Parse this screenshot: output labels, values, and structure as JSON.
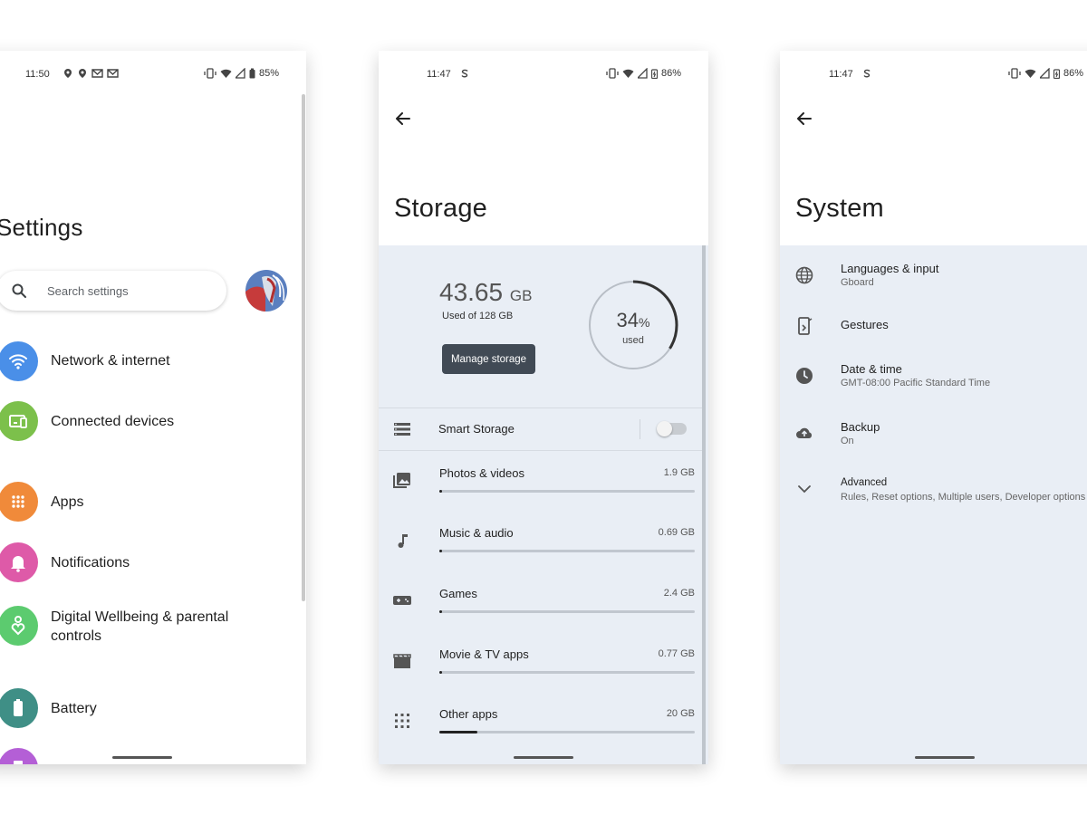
{
  "phone1": {
    "status": {
      "time": "11:50",
      "battery": "85%"
    },
    "title": "Settings",
    "search_placeholder": "Search settings",
    "items": [
      {
        "label": "Network & internet",
        "color": "#4a8fe8",
        "icon": "wifi-icon"
      },
      {
        "label": "Connected devices",
        "color": "#7cc04b",
        "icon": "connected-devices-icon"
      },
      {
        "label": "Apps",
        "color": "#f08a3a",
        "icon": "apps-grid-icon"
      },
      {
        "label": "Notifications",
        "color": "#de5aa8",
        "icon": "bell-icon"
      },
      {
        "label": "Digital Wellbeing & parental controls",
        "color": "#5ccb6f",
        "icon": "wellbeing-icon"
      },
      {
        "label": "Battery",
        "color": "#3f8f86",
        "icon": "battery-icon"
      }
    ]
  },
  "phone2": {
    "status": {
      "time": "11:47",
      "battery": "86%"
    },
    "title": "Storage",
    "used_value": "43.65",
    "used_unit": "GB",
    "used_of": "Used of 128 GB",
    "manage_label": "Manage storage",
    "percent": 34,
    "percent_value": "34",
    "percent_sign": "%",
    "percent_label": "used",
    "smart_storage_label": "Smart Storage",
    "smart_storage_on": false,
    "items": [
      {
        "label": "Photos & videos",
        "size": "1.9 GB",
        "fraction": 0.01,
        "icon": "photo-icon"
      },
      {
        "label": "Music & audio",
        "size": "0.69 GB",
        "fraction": 0.0,
        "icon": "music-note-icon"
      },
      {
        "label": "Games",
        "size": "2.4 GB",
        "fraction": 0.01,
        "icon": "gamepad-icon"
      },
      {
        "label": "Movie & TV apps",
        "size": "0.77 GB",
        "fraction": 0.0,
        "icon": "clapperboard-icon"
      },
      {
        "label": "Other apps",
        "size": "20 GB",
        "fraction": 0.15,
        "icon": "apps-grid-icon"
      }
    ]
  },
  "phone3": {
    "status": {
      "time": "11:47",
      "battery": "86%"
    },
    "title": "System",
    "items": [
      {
        "title": "Languages & input",
        "subtitle": "Gboard",
        "icon": "globe-icon"
      },
      {
        "title": "Gestures",
        "subtitle": "",
        "icon": "gesture-phone-icon"
      },
      {
        "title": "Date & time",
        "subtitle": "GMT-08:00 Pacific Standard Time",
        "icon": "clock-icon"
      },
      {
        "title": "Backup",
        "subtitle": "On",
        "icon": "cloud-upload-icon"
      },
      {
        "title": "Advanced",
        "subtitle": "Rules, Reset options, Multiple users, Developer options",
        "icon": "chevron-down-icon"
      }
    ]
  }
}
